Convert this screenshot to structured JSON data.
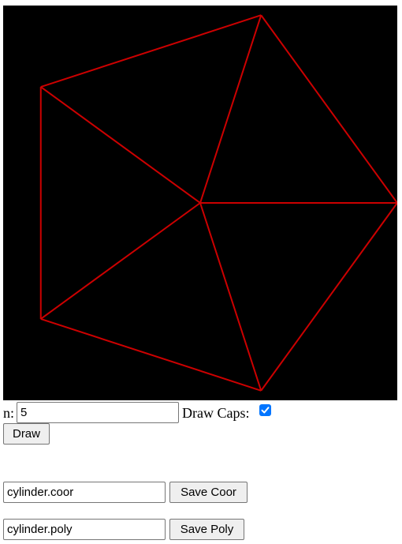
{
  "canvas": {
    "background": "#000000",
    "stroke": "#cc0000",
    "n": 5,
    "radius_fraction": 0.5,
    "rotation_deg": 0
  },
  "controls": {
    "n_label": "n:",
    "n_value": "5",
    "draw_caps_label": "Draw Caps:",
    "draw_caps_checked": true,
    "draw_button": "Draw"
  },
  "save": {
    "coor_filename": "cylinder.coor",
    "coor_button": "Save Coor",
    "poly_filename": "cylinder.poly",
    "poly_button": "Save Poly"
  },
  "colors": {
    "checkbox_accent": "#0075ff"
  }
}
